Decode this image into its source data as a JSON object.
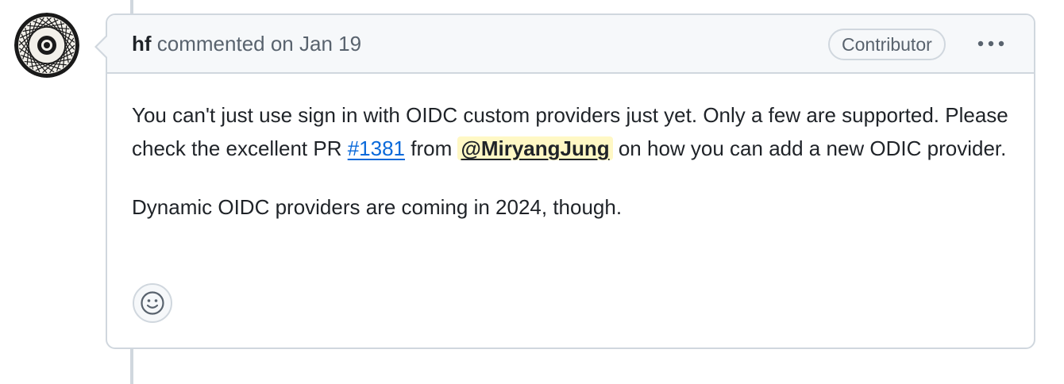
{
  "comment": {
    "author": "hf",
    "action": "commented on",
    "date": "Jan 19",
    "role_badge": "Contributor",
    "body": {
      "p1_part1": "You can't just use sign in with OIDC custom providers just yet. Only a few are supported. Please check the excellent PR ",
      "issue_link": "#1381",
      "p1_part2": " from ",
      "mention": "@MiryangJung",
      "p1_part3": " on how you can add a new ODIC provider.",
      "p2": "Dynamic OIDC providers are coming in 2024, though."
    }
  },
  "icons": {
    "menu": "kebab-horizontal-icon",
    "reaction": "smiley-icon",
    "avatar": "user-avatar"
  },
  "colors": {
    "link": "#0969da",
    "mention_bg": "#fff8c5",
    "border": "#d0d7de",
    "header_bg": "#f6f8fa",
    "muted_text": "#59636e"
  }
}
